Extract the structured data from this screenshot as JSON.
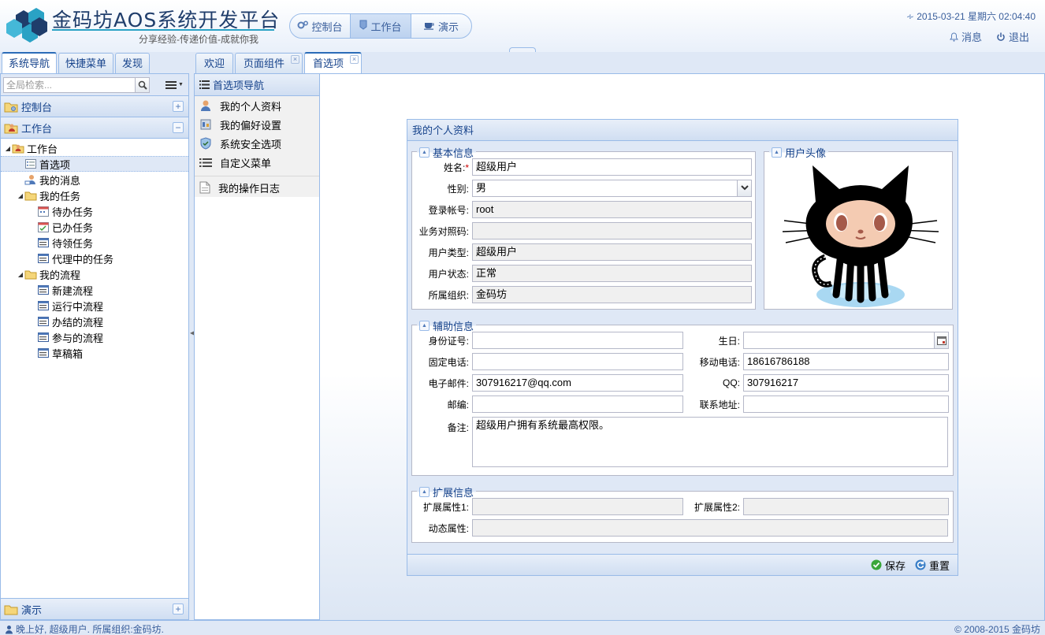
{
  "header": {
    "title": "金码坊AOS系统开发平台",
    "subtitle": "分享经验-传递价值-成就你我",
    "modes": [
      {
        "label": "控制台",
        "icon": "gears-icon",
        "active": false
      },
      {
        "label": "工作台",
        "icon": "tag-icon",
        "active": true
      },
      {
        "label": "演示",
        "icon": "cup-icon",
        "active": false
      }
    ],
    "datetime": "2015-03-21 星期六 02:04:40",
    "messages_label": "消息",
    "logout_label": "退出"
  },
  "left_tabs": [
    "系统导航",
    "快捷菜单",
    "发现"
  ],
  "sidebar": {
    "search_placeholder": "全局检索...",
    "accordions": {
      "console": "控制台",
      "workbench": "工作台",
      "demo": "演示"
    },
    "tree": {
      "root": "工作台",
      "prefs": "首选项",
      "messages": "我的消息",
      "tasks": "我的任务",
      "task_items": [
        "待办任务",
        "已办任务",
        "待领任务",
        "代理中的任务"
      ],
      "flows": "我的流程",
      "flow_items": [
        "新建流程",
        "运行中流程",
        "办结的流程",
        "参与的流程",
        "草稿箱"
      ]
    }
  },
  "main_tabs": [
    {
      "label": "欢迎",
      "closable": false
    },
    {
      "label": "页面组件",
      "closable": true
    },
    {
      "label": "首选项",
      "closable": true
    }
  ],
  "pref_nav": {
    "title": "首选项导航",
    "items": [
      "我的个人资料",
      "我的偏好设置",
      "系统安全选项",
      "自定义菜单"
    ],
    "log_item": "我的操作日志"
  },
  "form": {
    "title": "我的个人资料",
    "basic": {
      "legend": "基本信息",
      "name_label": "姓名:",
      "name_required": "*",
      "name": "超级用户",
      "gender_label": "性别:",
      "gender": "男",
      "account_label": "登录帐号:",
      "account": "root",
      "bizcode_label": "业务对照码:",
      "bizcode": "",
      "usertype_label": "用户类型:",
      "usertype": "超级用户",
      "status_label": "用户状态:",
      "status": "正常",
      "org_label": "所属组织:",
      "org": "金码坊"
    },
    "avatar": {
      "legend": "用户头像"
    },
    "aux": {
      "legend": "辅助信息",
      "idcard_label": "身份证号:",
      "idcard": "",
      "birthday_label": "生日:",
      "birthday": "",
      "phone_label": "固定电话:",
      "phone": "",
      "mobile_label": "移动电话:",
      "mobile": "18616786188",
      "email_label": "电子邮件:",
      "email": "307916217@qq.com",
      "qq_label": "QQ:",
      "qq": "307916217",
      "zip_label": "邮编:",
      "zip": "",
      "address_label": "联系地址:",
      "address": "",
      "remark_label": "备注:",
      "remark": "超级用户拥有系统最高权限。"
    },
    "ext": {
      "legend": "扩展信息",
      "ext1_label": "扩展属性1:",
      "ext1": "",
      "ext2_label": "扩展属性2:",
      "ext2": "",
      "dyn_label": "动态属性:",
      "dyn": ""
    },
    "save_label": "保存",
    "reset_label": "重置"
  },
  "statusbar": {
    "greeting": "晚上好, 超级用户. 所属组织:金码坊.",
    "copyright": "© 2008-2015 金码坊"
  },
  "colors": {
    "accent": "#15428b",
    "border": "#99bbe8",
    "panel": "#dfe8f6"
  }
}
